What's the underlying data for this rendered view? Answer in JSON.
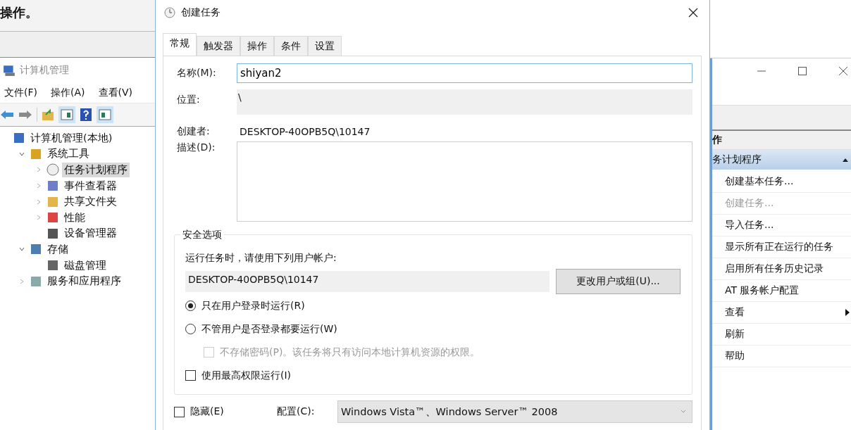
{
  "background_window": {
    "prompt_text": "操作。",
    "title": "计算机管理",
    "menu": [
      "文件(F)",
      "操作(A)",
      "查看(V)"
    ],
    "tree": [
      {
        "label": "计算机管理(本地)",
        "selected": false,
        "children": [
          {
            "label": "系统工具",
            "expanded": true,
            "selected": false,
            "children": [
              {
                "label": "任务计划程序",
                "expanded": false,
                "selected": true
              },
              {
                "label": "事件查看器",
                "expanded": false,
                "selected": false
              },
              {
                "label": "共享文件夹",
                "expanded": false,
                "selected": false
              },
              {
                "label": "性能",
                "expanded": false,
                "selected": false
              },
              {
                "label": "设备管理器",
                "selected": false
              }
            ]
          },
          {
            "label": "存储",
            "expanded": true,
            "selected": false,
            "children": [
              {
                "label": "磁盘管理",
                "selected": false
              }
            ]
          },
          {
            "label": "服务和应用程序",
            "expanded": false,
            "selected": false
          }
        ]
      }
    ],
    "actions_panel": {
      "header": "作",
      "section": "务计划程序",
      "items": [
        {
          "label": "创建基本任务...",
          "disabled": false,
          "submenu": false
        },
        {
          "label": "创建任务...",
          "disabled": true,
          "submenu": false
        },
        {
          "label": "导入任务...",
          "disabled": false,
          "submenu": false
        },
        {
          "label": "显示所有正在运行的任务",
          "disabled": false,
          "submenu": false
        },
        {
          "label": "启用所有任务历史记录",
          "disabled": false,
          "submenu": false
        },
        {
          "label": "AT 服务帐户配置",
          "disabled": false,
          "submenu": false
        },
        {
          "label": "查看",
          "disabled": false,
          "submenu": true
        },
        {
          "label": "刷新",
          "disabled": false,
          "submenu": false
        },
        {
          "label": "帮助",
          "disabled": false,
          "submenu": false
        }
      ]
    }
  },
  "dialog": {
    "title": "创建任务",
    "tabs": [
      {
        "label": "常规",
        "selected": true
      },
      {
        "label": "触发器",
        "selected": false
      },
      {
        "label": "操作",
        "selected": false
      },
      {
        "label": "条件",
        "selected": false
      },
      {
        "label": "设置",
        "selected": false
      }
    ],
    "name": {
      "label": "名称(M):",
      "value": "shiyan2"
    },
    "location": {
      "label": "位置:",
      "value": "\\"
    },
    "author": {
      "label": "创建者:",
      "value": "DESKTOP-40OPB5Q\\10147"
    },
    "description": {
      "label": "描述(D):"
    },
    "security": {
      "title": "安全选项",
      "account_prompt": "运行任务时，请使用下列用户帐户:",
      "account": "DESKTOP-40OPB5Q\\10147",
      "change_button": "更改用户或组(U)...",
      "run_options": [
        {
          "label": "只在用户登录时运行(R)",
          "selected": true
        },
        {
          "label": "不管用户是否登录都要运行(W)",
          "selected": false
        }
      ],
      "no_store_password": {
        "label": "不存储密码(P)。该任务将只有访问本地计算机资源的权限。",
        "checked": false,
        "disabled": true
      },
      "highest_privileges": {
        "label": "使用最高权限运行(I)",
        "checked": false,
        "disabled": false
      }
    },
    "hidden": {
      "label": "隐藏(E)",
      "checked": false,
      "disabled": false
    },
    "configure": {
      "label": "配置(C):",
      "value": "Windows Vista™、Windows Server™ 2008"
    }
  }
}
